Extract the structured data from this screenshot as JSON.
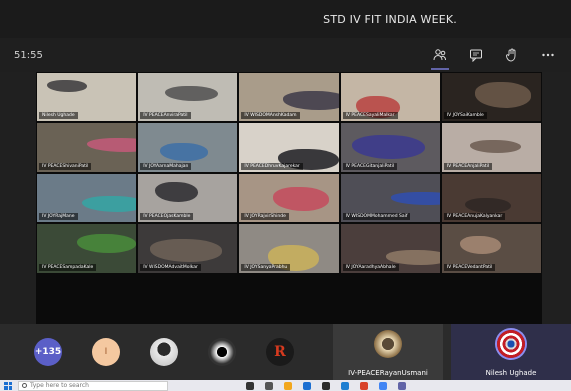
{
  "window": {
    "title": "STD IV FIT INDIA WEEK."
  },
  "toolbar": {
    "timer": "51:55",
    "tools": [
      {
        "icon": "participants-icon",
        "active": true
      },
      {
        "icon": "chat-icon",
        "active": false
      },
      {
        "icon": "raise-hand-icon",
        "active": false
      },
      {
        "icon": "more-options-icon",
        "active": false
      }
    ]
  },
  "grid": {
    "tiles": [
      {
        "name": "Nilesh Ughade",
        "bg": "#c9c3b6",
        "fg": "#3b3a3c"
      },
      {
        "name": "IV PEACEAnviraPatil",
        "bg": "#bfbcb4",
        "fg": "#505050"
      },
      {
        "name": "IV WISDOMAnshKadam",
        "bg": "#a99c8a",
        "fg": "#3d3a48"
      },
      {
        "name": "IV PEACESayaliMalkar",
        "bg": "#c4b6a5",
        "fg": "#b8423f"
      },
      {
        "name": "IV JOYSaiKamble",
        "bg": "#2a2420",
        "fg": "#6d5a4b"
      },
      {
        "name": "IV PEACEShivaniPatil",
        "bg": "#6a6255",
        "fg": "#c45a7a"
      },
      {
        "name": "IV JOYAarnaMahajan",
        "bg": "#7f8a90",
        "fg": "#3d6fa7"
      },
      {
        "name": "IV PEACEDhruvKajarekar",
        "bg": "#d8d2c9",
        "fg": "#1d1d22"
      },
      {
        "name": "IV PEACEGitanjaliPatil",
        "bg": "#5d5a5f",
        "fg": "#3b3a8f"
      },
      {
        "name": "IV PEACEAnjaliPatil",
        "bg": "#b9ada5",
        "fg": "#6b5a50"
      },
      {
        "name": "IV JOYRajMane",
        "bg": "#6b7b88",
        "fg": "#34a6a4"
      },
      {
        "name": "IV PEACEOjasKamble",
        "bg": "#a7a39f",
        "fg": "#2b2b2f"
      },
      {
        "name": "IV JOYRajvirShinde",
        "bg": "#a79585",
        "fg": "#c44b5d"
      },
      {
        "name": "IV WISDOMMohammed Saif",
        "bg": "#4f4e56",
        "fg": "#2f4fb0"
      },
      {
        "name": "IV PEACEAnujaKalyankar",
        "bg": "#4a3a33",
        "fg": "#2e2725"
      },
      {
        "name": "IV PEACESampadaKale",
        "bg": "#3b4a37",
        "fg": "#4a8c3b"
      },
      {
        "name": "IV WISDOMAdvaitMolkar",
        "bg": "#3d3a3a",
        "fg": "#6f6358"
      },
      {
        "name": "IV JOYSanyaPrabhu",
        "bg": "#8f8a84",
        "fg": "#cbb15a"
      },
      {
        "name": "IV JOYAaradhyaAbhale",
        "bg": "#4b3e3c",
        "fg": "#8f7a66"
      },
      {
        "name": "IV PEACEVedantPatil",
        "bg": "#5a4d44",
        "fg": "#a78a74"
      }
    ]
  },
  "participants": {
    "overflow_count": "+135",
    "initial": "I",
    "rlogo": "R",
    "featured": [
      {
        "name": "IV-PEACERayanUsmani"
      },
      {
        "name": "Nilesh Ughade"
      }
    ]
  },
  "taskbar": {
    "search_placeholder": "Type here to search",
    "icon_colors": [
      "#333",
      "#555",
      "#f2a71d",
      "#1c6fd1",
      "#2b2b2b",
      "#1f7fd1",
      "#d8432b",
      "#4285f4",
      "#6264a7"
    ]
  }
}
